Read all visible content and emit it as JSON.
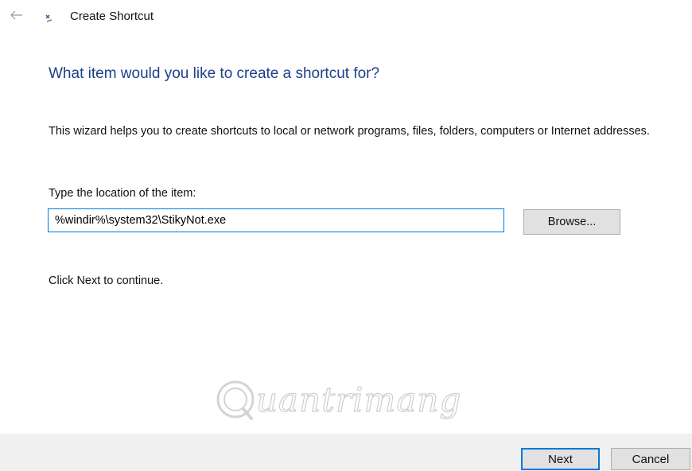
{
  "window": {
    "title": "Create Shortcut",
    "back_icon": "arrow-left-icon",
    "app_icon": "shortcut-wizard-icon"
  },
  "main": {
    "heading": "What item would you like to create a shortcut for?",
    "description": "This wizard helps you to create shortcuts to local or network programs, files, folders, computers or Internet addresses.",
    "location_label": "Type the location of the item:",
    "location_value": "%windir%\\system32\\StikyNot.exe",
    "browse_label": "Browse...",
    "hint": "Click Next to continue."
  },
  "watermark": {
    "text": "uantrimang",
    "icon": "quantrimang-logo"
  },
  "footer": {
    "next_label": "Next",
    "cancel_label": "Cancel"
  },
  "colors": {
    "heading": "#1e3f8a",
    "focus_border": "#0078d7",
    "footer_bg": "#f0f0f0",
    "button_bg": "#e1e1e1"
  }
}
